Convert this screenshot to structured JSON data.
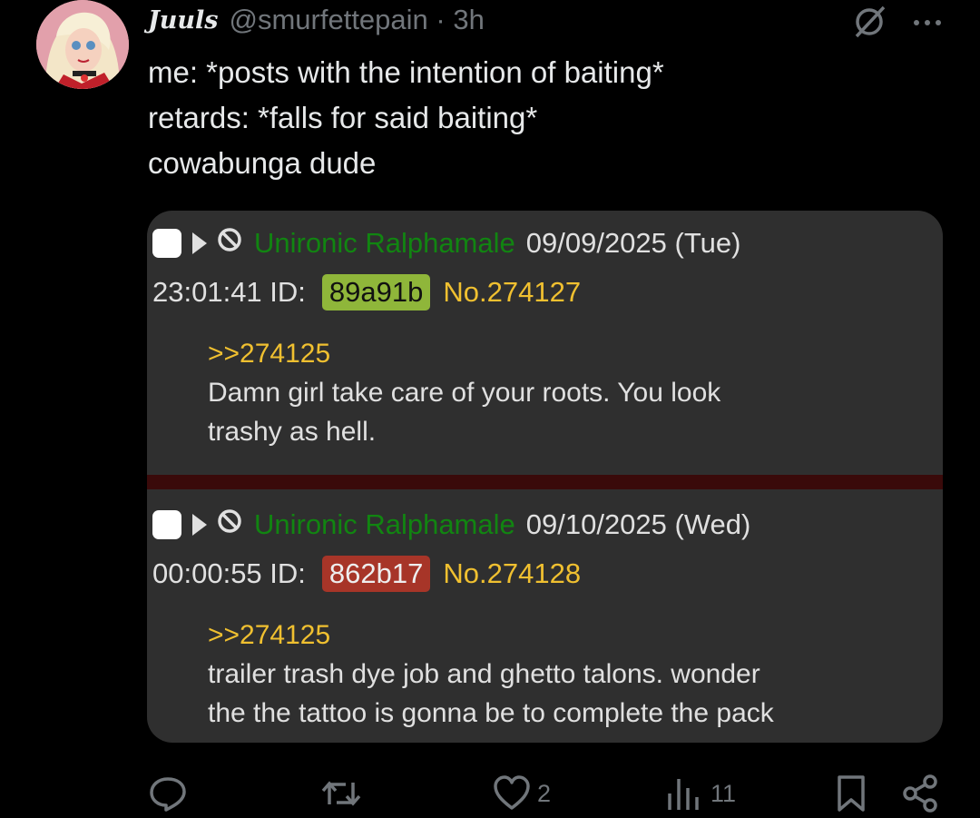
{
  "tweet": {
    "display_name": "Juuls",
    "handle_time": "@smurfettepain · 3h",
    "lines": [
      "me: *posts with the intention of baiting*",
      "retards: *falls for said baiting*",
      "cowabunga dude"
    ]
  },
  "quote": {
    "posts": [
      {
        "name": "Unironic Ralphamale",
        "date": "09/09/2025 (Tue)",
        "time": "23:01:41",
        "id_label": "ID:",
        "id": "89a91b",
        "number": "No.274127",
        "reply_to": ">>274125",
        "body_lines": [
          "Damn girl take care of your roots. You look",
          "trashy as hell."
        ]
      },
      {
        "name": "Unironic Ralphamale",
        "date": "09/10/2025 (Wed)",
        "time": "00:00:55",
        "id_label": "ID:",
        "id": "862b17",
        "number": "No.274128",
        "reply_to": ">>274125",
        "body_lines": [
          "trailer trash dye job and ghetto talons. wonder",
          "the the tattoo is gonna be to complete the pack"
        ]
      }
    ]
  },
  "actions": {
    "likes": "2",
    "views": "11"
  },
  "icons": [
    "reply-icon",
    "retweet-icon",
    "like-icon",
    "views-icon",
    "bookmark-icon",
    "share-icon",
    "grok-icon",
    "more-icon"
  ],
  "colors": {
    "background": "#000000",
    "card": "#2f2f2f",
    "name_green": "#118511",
    "quote_yellow": "#f0c030",
    "id_green": "#8fb63a",
    "id_red": "#a73528"
  }
}
